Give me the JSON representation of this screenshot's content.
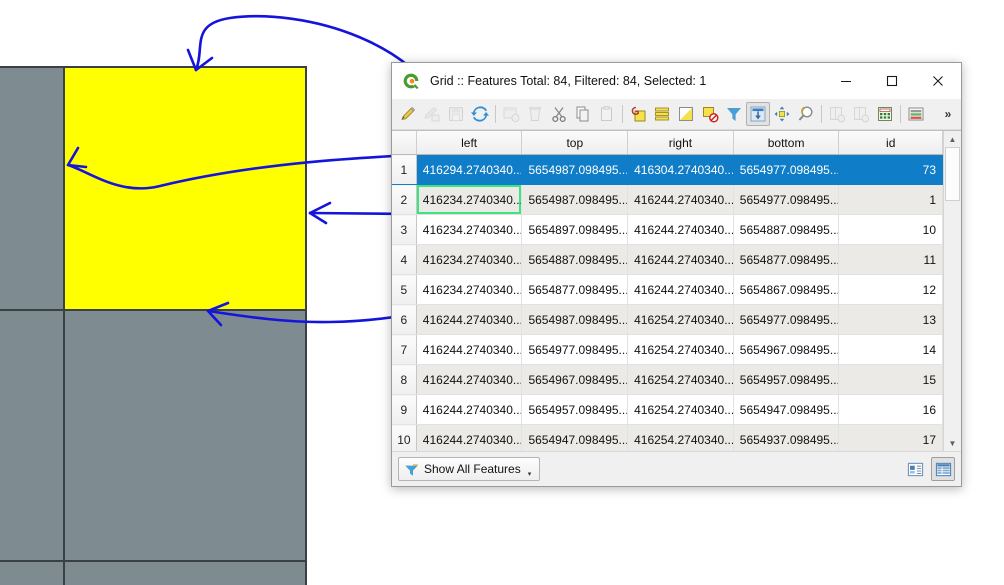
{
  "map": {
    "background_color": "#ffffff",
    "cell_color": "#7e8b90",
    "highlight_color": "#ffff00",
    "gridline_color": "#3a4145",
    "annotation_color": "#1414dc"
  },
  "window": {
    "title": "Grid :: Features Total: 84, Filtered: 84, Selected: 1",
    "logo_icon": "qgis-logo-icon",
    "controls": {
      "minimize": "—",
      "maximize": "☐",
      "close": "✕"
    }
  },
  "toolbar": {
    "overflow_label": "»",
    "items": [
      {
        "name": "toggle-editing-icon",
        "label": "Toggle editing mode"
      },
      {
        "name": "save-edits-icon",
        "label": "Save edits"
      },
      {
        "name": "save-layer-edits-icon",
        "label": "Save layer edits"
      },
      {
        "name": "reload-table-icon",
        "label": "Reload the table"
      },
      {
        "name": "add-feature-icon",
        "label": "Add feature"
      },
      {
        "name": "delete-selected-icon",
        "label": "Delete selected features"
      },
      {
        "name": "cut-features-icon",
        "label": "Cut features"
      },
      {
        "name": "copy-features-icon",
        "label": "Copy features"
      },
      {
        "name": "paste-features-icon",
        "label": "Paste features"
      },
      {
        "name": "select-by-expression-icon",
        "label": "Select features using an expression"
      },
      {
        "name": "select-all-icon",
        "label": "Select all features"
      },
      {
        "name": "invert-selection-icon",
        "label": "Invert selection"
      },
      {
        "name": "deselect-all-icon",
        "label": "Deselect all features"
      },
      {
        "name": "filter-selection-icon",
        "label": "Filter / select using form"
      },
      {
        "name": "move-selection-to-top-icon",
        "label": "Move selection to top",
        "pressed": true
      },
      {
        "name": "pan-to-selected-icon",
        "label": "Pan map to the selected rows"
      },
      {
        "name": "zoom-to-selected-icon",
        "label": "Zoom map to the selected rows"
      },
      {
        "name": "new-column-icon",
        "label": "New field"
      },
      {
        "name": "delete-column-icon",
        "label": "Delete field"
      },
      {
        "name": "open-field-calculator-icon",
        "label": "Open field calculator"
      },
      {
        "name": "conditional-formatting-icon",
        "label": "Conditional formatting"
      }
    ]
  },
  "table": {
    "columns": [
      "left",
      "top",
      "right",
      "bottom",
      "id"
    ],
    "rows": [
      {
        "n": "1",
        "left": "416294.2740340...",
        "top": "5654987.098495...",
        "right": "416304.2740340...",
        "bottom": "5654977.098495...",
        "id": "73",
        "selected": true
      },
      {
        "n": "2",
        "left": "416234.2740340...",
        "top": "5654987.098495...",
        "right": "416244.2740340...",
        "bottom": "5654977.098495...",
        "id": "1",
        "focus": true
      },
      {
        "n": "3",
        "left": "416234.2740340...",
        "top": "5654897.098495...",
        "right": "416244.2740340...",
        "bottom": "5654887.098495...",
        "id": "10"
      },
      {
        "n": "4",
        "left": "416234.2740340...",
        "top": "5654887.098495...",
        "right": "416244.2740340...",
        "bottom": "5654877.098495...",
        "id": "11"
      },
      {
        "n": "5",
        "left": "416234.2740340...",
        "top": "5654877.098495...",
        "right": "416244.2740340...",
        "bottom": "5654867.098495...",
        "id": "12"
      },
      {
        "n": "6",
        "left": "416244.2740340...",
        "top": "5654987.098495...",
        "right": "416254.2740340...",
        "bottom": "5654977.098495...",
        "id": "13"
      },
      {
        "n": "7",
        "left": "416244.2740340...",
        "top": "5654977.098495...",
        "right": "416254.2740340...",
        "bottom": "5654967.098495...",
        "id": "14"
      },
      {
        "n": "8",
        "left": "416244.2740340...",
        "top": "5654967.098495...",
        "right": "416254.2740340...",
        "bottom": "5654957.098495...",
        "id": "15"
      },
      {
        "n": "9",
        "left": "416244.2740340...",
        "top": "5654957.098495...",
        "right": "416254.2740340...",
        "bottom": "5654947.098495...",
        "id": "16"
      },
      {
        "n": "10",
        "left": "416244.2740340...",
        "top": "5654947.098495...",
        "right": "416254.2740340...",
        "bottom": "5654937.098495...",
        "id": "17"
      }
    ],
    "selected_row_color": "#0f7dc8",
    "focus_outline_color": "#3ce37e",
    "alt_row_color": "#ebeae6"
  },
  "status_bar": {
    "filter_label": "Show All Features",
    "filter_icon": "funnel-filter-icon",
    "filter_caret": "▾",
    "form_view_label": "Switch to form view",
    "table_view_label": "Switch to table view"
  },
  "scrollbar": {
    "up_arrow": "▲",
    "down_arrow": "▼"
  }
}
